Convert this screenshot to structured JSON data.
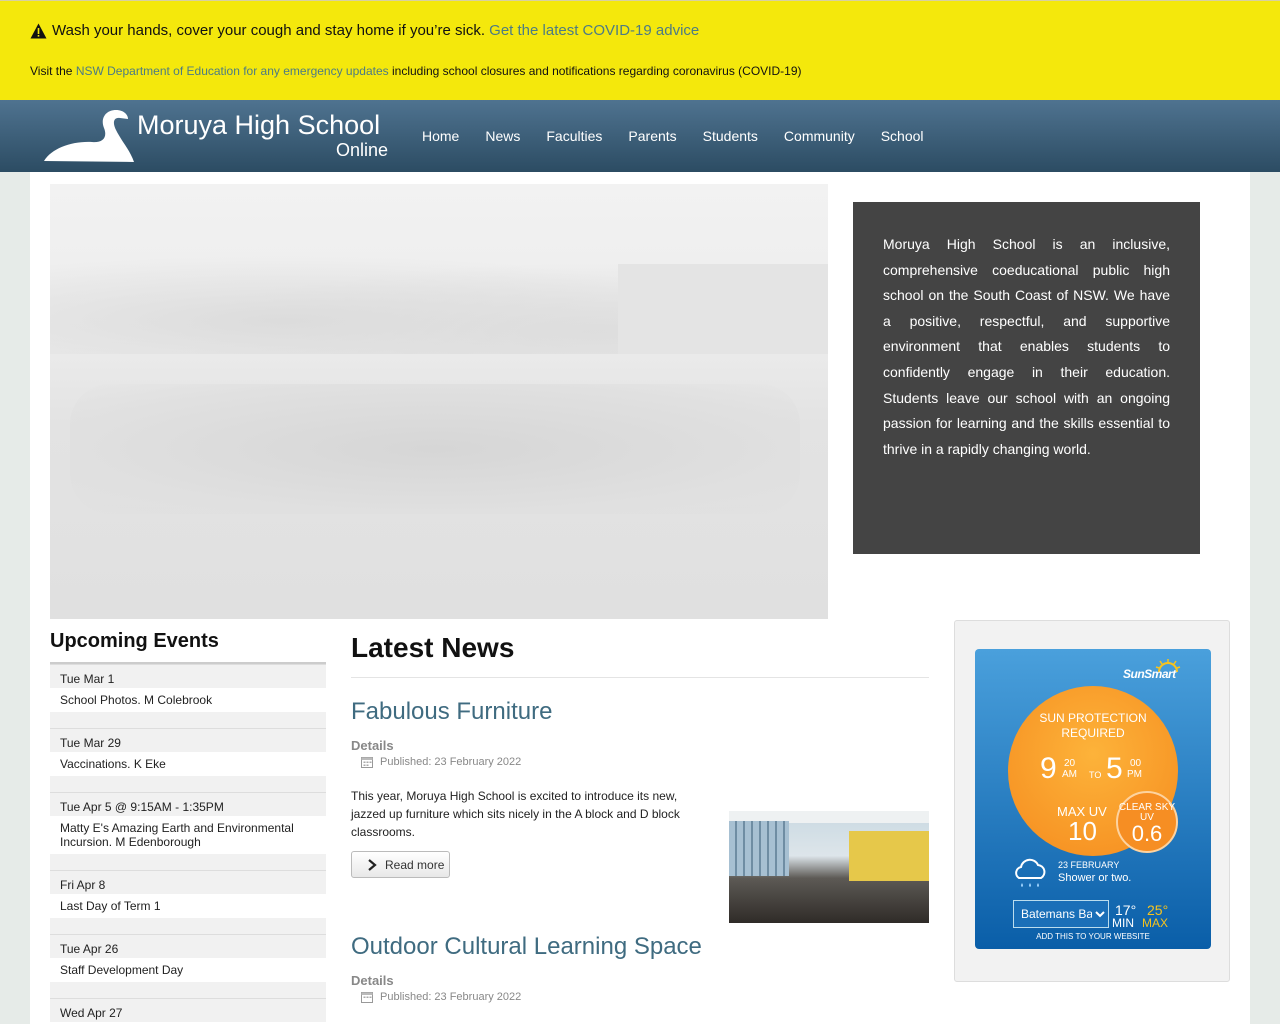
{
  "alert": {
    "line1_text": "Wash your hands, cover your cough and stay home if you’re sick.",
    "line1_link": "Get the latest COVID-19 advice",
    "line2_prefix": "Visit the",
    "line2_link": "NSW Department of Education for any emergency updates",
    "line2_suffix": "including school closures and notifications regarding coronavirus (COVID-19)"
  },
  "header": {
    "logo_title": "Moruya High School",
    "logo_subtitle": "Online",
    "nav": [
      "Home",
      "News",
      "Faculties",
      "Parents",
      "Students",
      "Community",
      "School"
    ]
  },
  "intro": {
    "text": "Moruya High School is an inclusive, comprehensive coeducational public high school on the South Coast of NSW. We have a positive, respectful, and supportive environment that enables students to confidently engage in their education. Students leave our school with an ongoing passion for learning and the skills essential to thrive in a rapidly changing world."
  },
  "events": {
    "heading": "Upcoming Events",
    "items": [
      {
        "date": "Tue Mar 1",
        "title": "School Photos. M Colebrook"
      },
      {
        "date": "Tue Mar 29",
        "title": "Vaccinations. K Eke"
      },
      {
        "date": "Tue Apr 5 @ 9:15AM - 1:35PM",
        "title": "Matty E's Amazing Earth and Environmental Incursion. M Edenborough"
      },
      {
        "date": "Fri Apr 8",
        "title": "Last Day of Term 1"
      },
      {
        "date": "Tue Apr 26",
        "title": "Staff Development Day"
      },
      {
        "date": "Wed Apr 27",
        "title": ""
      }
    ]
  },
  "news": {
    "heading": "Latest News",
    "articles": [
      {
        "title": "Fabulous Furniture",
        "details_label": "Details",
        "published": "Published: 23 February 2022",
        "text": "This year, Moruya High School is excited to introduce its new, jazzed up furniture which sits nicely in the A block and D block classrooms.",
        "read_more": "Read more"
      },
      {
        "title": "Outdoor Cultural Learning Space",
        "details_label": "Details",
        "published": "Published: 23 February 2022"
      }
    ]
  },
  "uv": {
    "logo_text": "SunSmart",
    "required_label": "SUN PROTECTION REQUIRED",
    "from_hour": "9",
    "from_min": "20",
    "from_ampm": "AM",
    "to_label": "TO",
    "to_hour": "5",
    "to_min": "00",
    "to_ampm": "PM",
    "max_uv_label": "MAX UV",
    "max_uv_value": "10",
    "clear_sky_label": "CLEAR SKY UV",
    "clear_sky_value": "0.6",
    "forecast_date": "23 FEBRUARY",
    "forecast_desc": "Shower or two.",
    "location_selected": "Batemans Bay",
    "temp_min": "17",
    "temp_max": "25",
    "min_label": "MIN",
    "max_label": "MAX",
    "add_site": "ADD THIS TO YOUR WEBSITE"
  }
}
